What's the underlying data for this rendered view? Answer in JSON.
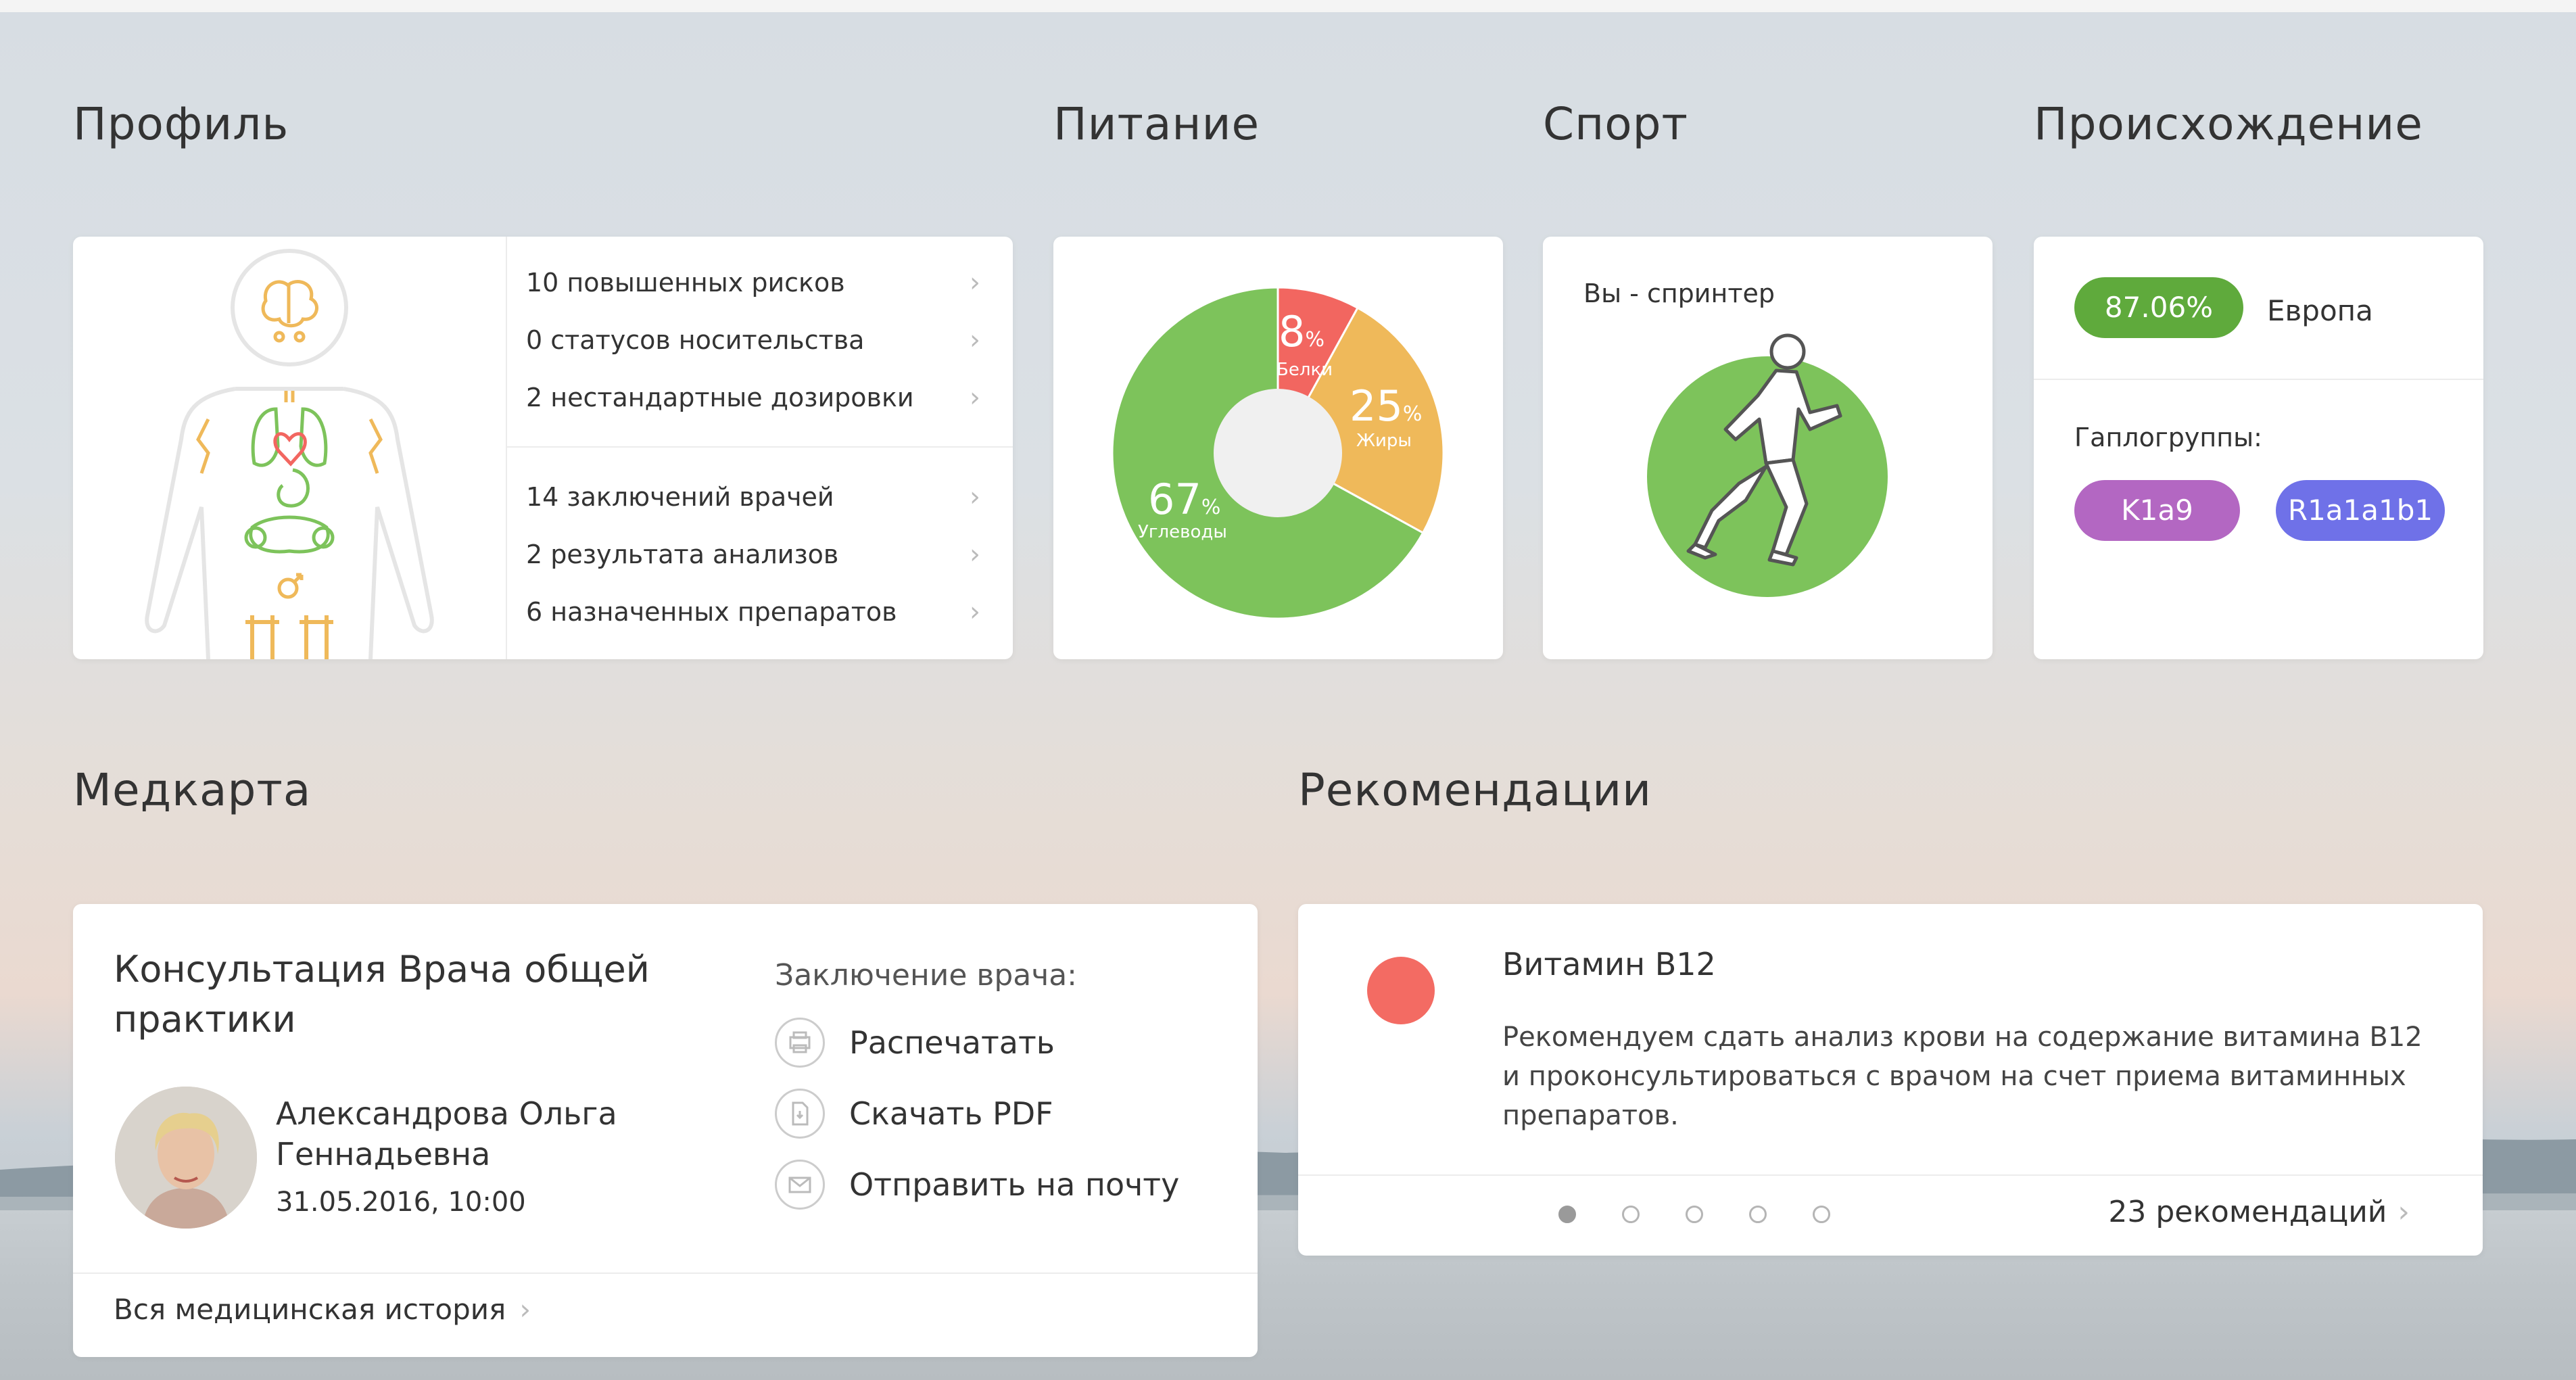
{
  "sections": {
    "profile": "Профиль",
    "nutrition": "Питание",
    "sport": "Спорт",
    "origin": "Происхождение",
    "medcard": "Медкарта",
    "recommendations": "Рекомендации"
  },
  "profile": {
    "links_top": [
      "10 повышенных рисков",
      "0 статусов носительства",
      "2 нестандартные дозировки"
    ],
    "links_bottom": [
      "14 заключений врачей",
      "2 результата анализов",
      "6 назначенных препаратов"
    ],
    "chevron": "›"
  },
  "nutrition": {
    "chart_data": {
      "type": "pie",
      "title": "",
      "slices": [
        {
          "label": "Белки",
          "value": 8,
          "color": "#f26660"
        },
        {
          "label": "Жиры",
          "value": 25,
          "color": "#efb95a"
        },
        {
          "label": "Углеводы",
          "value": 67,
          "color": "#7dc35b"
        }
      ]
    },
    "pct_8": "8",
    "pct_25": "25",
    "pct_67": "67",
    "pct_sign": "%",
    "label_proteins": "Белки",
    "label_fats": "Жиры",
    "label_carbs": "Углеводы"
  },
  "sport": {
    "label": "Вы - спринтер",
    "accent": "#7dc35b"
  },
  "origin": {
    "percent": "87.06%",
    "region": "Европа",
    "haplogroups_label": "Гаплогруппы:",
    "haplogroups": [
      "K1a9",
      "R1a1a1b1"
    ],
    "colors": {
      "europe": "#5faa3c",
      "h1": "#b367c2",
      "h2": "#6f71e8"
    }
  },
  "medcard": {
    "title": "Консультация Врача общей практики",
    "doctor_name": "Александрова Ольга Геннадьевна",
    "date": "31.05.2016, 10:00",
    "conclusion_label": "Заключение врача:",
    "actions": [
      "Распечатать",
      "Скачать PDF",
      "Отправить на почту"
    ],
    "history_link": "Вся медицинская история",
    "chevron": "›"
  },
  "recommendations": {
    "title": "Витамин B12",
    "text": "Рекомендуем сдать анализ крови на содержание витамина B12 и проконсультироваться с врачом на счет приема витаминных препаратов.",
    "count_label": "23 рекомендаций",
    "chevron": "›",
    "dot_color": "#f36b63",
    "pages": 5,
    "active_page": 1
  }
}
